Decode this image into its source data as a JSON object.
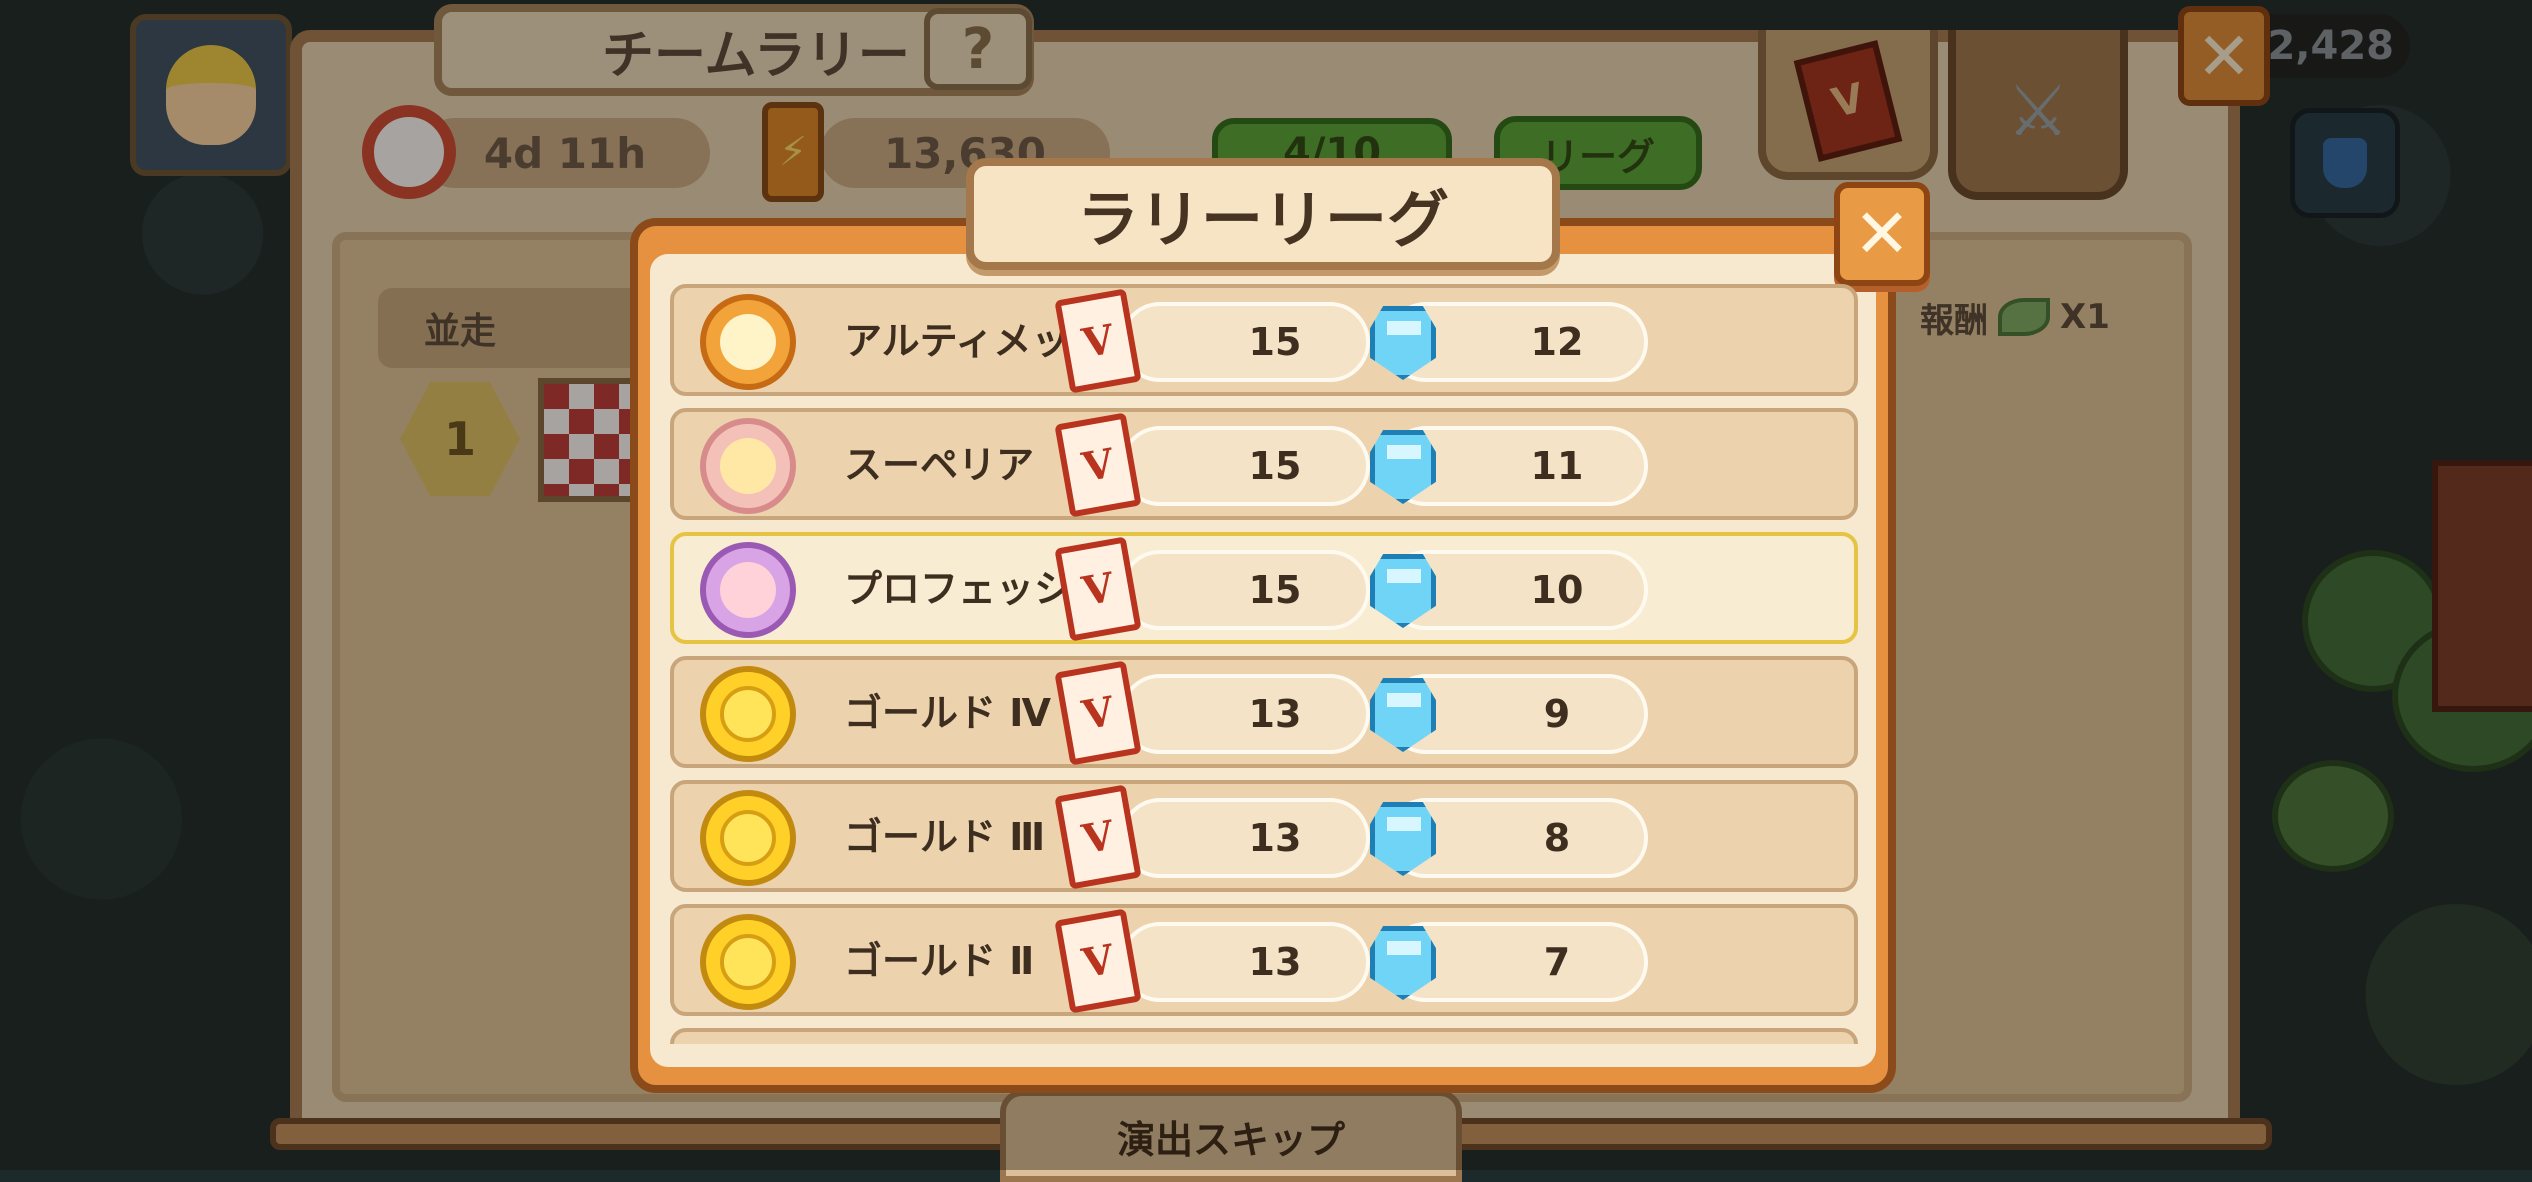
{
  "hud": {
    "coins": "2,428"
  },
  "board": {
    "title": "チームラリー",
    "help_label": "?",
    "timer": "4d 11h",
    "energy": "13,630",
    "energy_icon": "⚡",
    "gem_progress": "4/10",
    "league_button": "リーグ",
    "close_label": "✕",
    "race_label": "並走",
    "rank": "1",
    "reward_label": "報酬",
    "reward_multiplier": "X1",
    "skip_label": "演出スキップ",
    "tab_book_letter": "V",
    "tab_versus_glyph": "⚔"
  },
  "modal": {
    "title": "ラリーリーグ",
    "close_label": "✕",
    "card_letter": "V",
    "leagues": [
      {
        "name": "アルティメット",
        "badge": "chicken-sun",
        "badge_style": "b-ult",
        "cards": "15",
        "gems": "12",
        "selected": false
      },
      {
        "name": "スーペリア",
        "badge": "chicken-pink",
        "badge_style": "b-sup",
        "cards": "15",
        "gems": "11",
        "selected": false
      },
      {
        "name": "プロフェッショナル",
        "badge": "pig-flower",
        "badge_style": "b-pro",
        "cards": "15",
        "gems": "10",
        "selected": true
      },
      {
        "name": "ゴールド Ⅳ",
        "badge": "gold-apple",
        "badge_style": "b-gold",
        "cards": "13",
        "gems": "9",
        "selected": false
      },
      {
        "name": "ゴールド Ⅲ",
        "badge": "gold-apple",
        "badge_style": "b-gold",
        "cards": "13",
        "gems": "8",
        "selected": false
      },
      {
        "name": "ゴールド Ⅱ",
        "badge": "gold-pinecone",
        "badge_style": "b-gold",
        "cards": "13",
        "gems": "7",
        "selected": false
      }
    ]
  },
  "colors": {
    "modal_frame": "#e5913f",
    "selected_border": "#e5c443",
    "gem": "#6fd4f5",
    "card": "#b8341e",
    "league_button": "#58a93a"
  }
}
